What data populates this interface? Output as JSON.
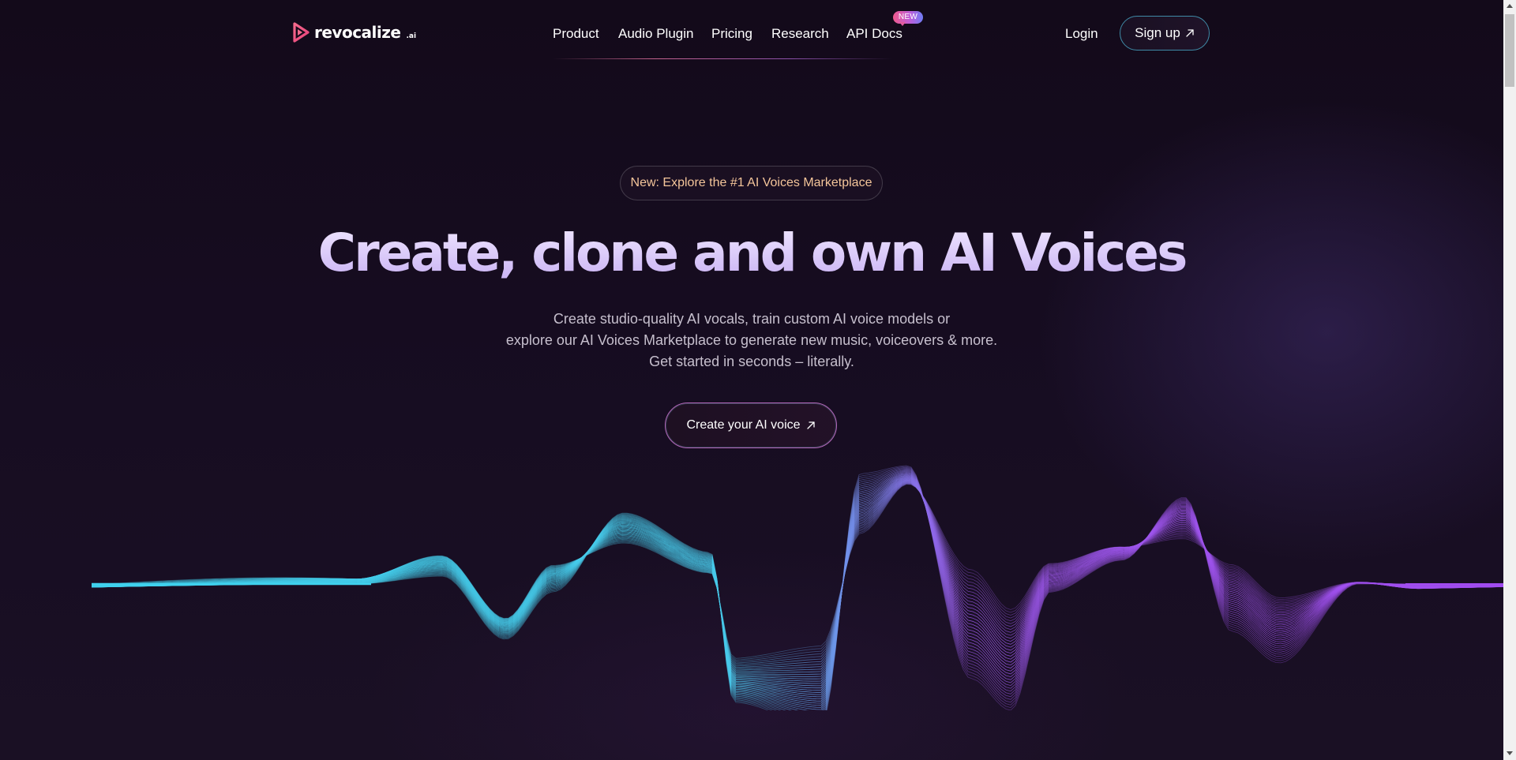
{
  "header": {
    "logo_text": "revocalize",
    "logo_suffix": ".ai",
    "nav": [
      {
        "label": "Product"
      },
      {
        "label": "Audio Plugin"
      },
      {
        "label": "Pricing"
      },
      {
        "label": "Research"
      },
      {
        "label": "API Docs",
        "badge": "NEW"
      }
    ],
    "login_label": "Login",
    "signup_label": "Sign up"
  },
  "hero": {
    "announcement": "New: Explore the #1 AI Voices Marketplace",
    "title": "Create, clone and own AI Voices",
    "subtitle_lines": [
      "Create studio-quality AI vocals, train custom AI voice models or",
      "explore our AI Voices Marketplace to generate new music, voiceovers & more.",
      "Get started in seconds – literally."
    ],
    "cta_label": "Create your AI voice"
  },
  "colors": {
    "background": "#140b1c",
    "wave_start": "#3fd2ee",
    "wave_end": "#a24cf2",
    "announcement_text": "#f4c59a",
    "title_gradient_top": "#efe6ff",
    "title_gradient_bottom": "#c9b2f4"
  },
  "icons": {
    "logo": "play-triangle-logo-icon",
    "external_arrow": "arrow-up-right-icon",
    "hero_graphic": "sound-wave-graphic"
  }
}
